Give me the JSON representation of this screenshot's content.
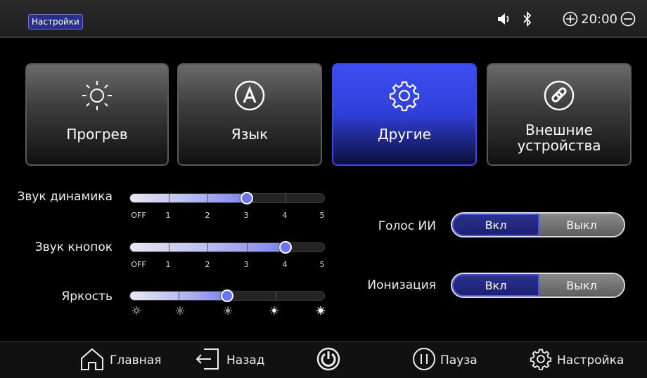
{
  "header": {
    "title": "Настройки",
    "time": "20:00",
    "icons": [
      "speaker-icon",
      "bluetooth-icon",
      "plus-circle-icon",
      "minus-circle-icon"
    ]
  },
  "tabs": [
    {
      "label": "Прогрев",
      "icon": "sun-icon",
      "active": false
    },
    {
      "label": "Язык",
      "icon": "letter-a-icon",
      "active": false
    },
    {
      "label": "Другие",
      "icon": "gear-icon",
      "active": true
    },
    {
      "label_line1": "Внешние",
      "label_line2": "устройства",
      "icon": "link-icon",
      "active": false
    }
  ],
  "sliders": {
    "speaker": {
      "label": "Звук динамика",
      "value": 3,
      "max": 5,
      "ticks": [
        "OFF",
        "1",
        "2",
        "3",
        "4",
        "5"
      ]
    },
    "buttons": {
      "label": "Звук кнопок",
      "value": 4,
      "max": 5,
      "ticks": [
        "OFF",
        "1",
        "2",
        "3",
        "4",
        "5"
      ]
    },
    "brightness": {
      "label": "Яркость",
      "value": 2.5,
      "max": 5,
      "icons": [
        "sun-small-icon",
        "sun-small-icon",
        "sun-small-icon",
        "sun-small-icon",
        "sun-small-icon"
      ]
    }
  },
  "toggles": {
    "voice": {
      "label": "Голос ИИ",
      "on_label": "Вкл",
      "off_label": "Выкл",
      "selected": "on"
    },
    "ionization": {
      "label": "Ионизация",
      "on_label": "Вкл",
      "off_label": "Выкл",
      "selected": "on"
    }
  },
  "bottom": {
    "home": "Главная",
    "back": "Назад",
    "pause": "Пауза",
    "settings": "Настройка"
  },
  "colors": {
    "accent": "#3b49e6",
    "knob": "#6a74f4"
  }
}
